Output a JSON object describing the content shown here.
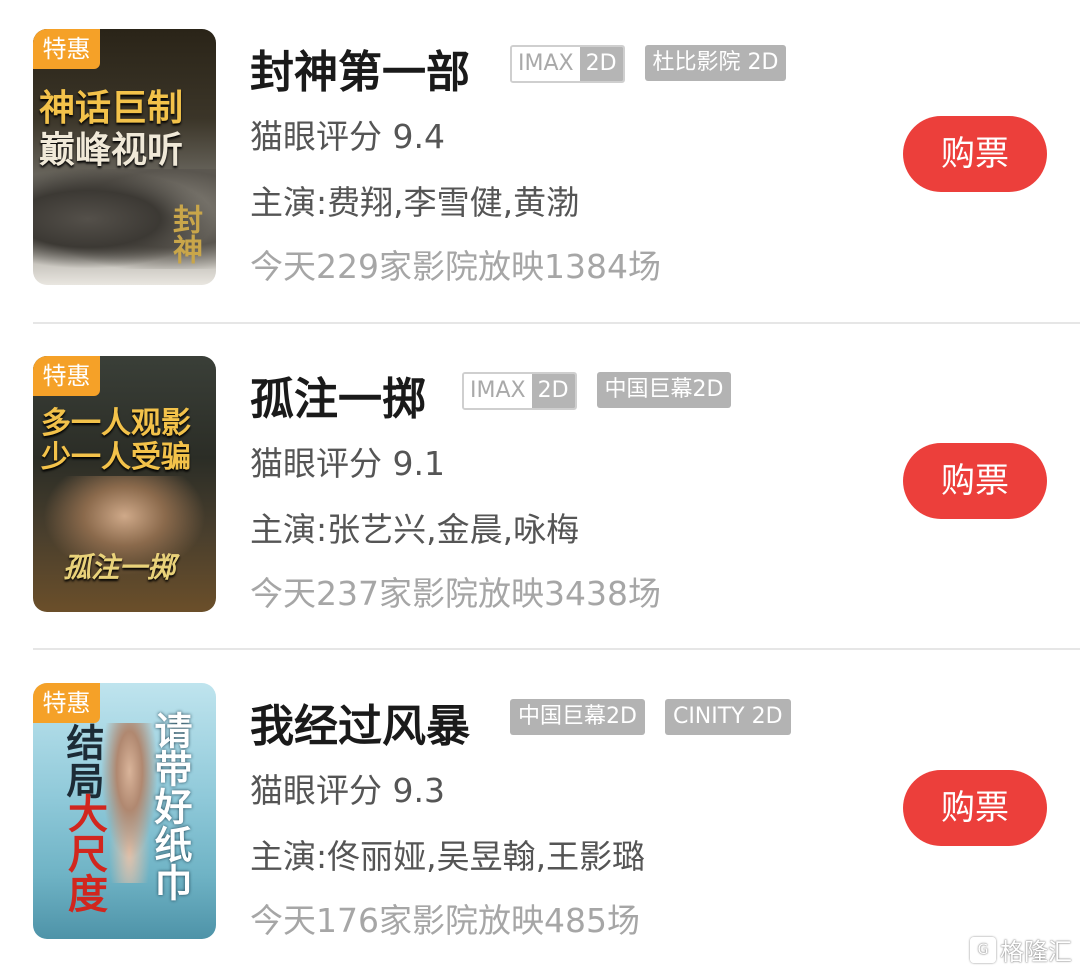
{
  "movies": [
    {
      "badge": "特惠",
      "title": "封神第一部",
      "tags": [
        {
          "type": "imax",
          "a": "IMAX",
          "b": "2D"
        },
        {
          "type": "solid",
          "text": "杜比影院 2D"
        }
      ],
      "rating": "猫眼评分 9.4",
      "cast": "主演:费翔,李雪健,黄渤",
      "shows": "今天229家影院放映1384场",
      "buy": "购票",
      "poster_lines": [
        "神话巨制",
        "巅峰视听",
        "封神"
      ]
    },
    {
      "badge": "特惠",
      "title": "孤注一掷",
      "tags": [
        {
          "type": "imax",
          "a": "IMAX",
          "b": "2D"
        },
        {
          "type": "solid",
          "text": "中国巨幕2D"
        }
      ],
      "rating": "猫眼评分 9.1",
      "cast": "主演:张艺兴,金晨,咏梅",
      "shows": "今天237家影院放映3438场",
      "buy": "购票",
      "poster_lines": [
        "多一人观影",
        "少一人受骗",
        "孤注一掷"
      ]
    },
    {
      "badge": "特惠",
      "title": "我经过风暴",
      "tags": [
        {
          "type": "solid",
          "text": "中国巨幕2D"
        },
        {
          "type": "solid",
          "text": "CINITY 2D"
        }
      ],
      "rating": "猫眼评分 9.3",
      "cast": "主演:佟丽娅,吴昱翰,王影璐",
      "shows": "今天176家影院放映485场",
      "buy": "购票",
      "poster_lines": [
        "结局",
        "大尺度",
        "请带好纸巾"
      ]
    }
  ],
  "watermark": "格隆汇",
  "colors": {
    "buy_button": "#ec3f3b",
    "badge": "#f5a128",
    "tag_gray": "#b3b3b3"
  }
}
